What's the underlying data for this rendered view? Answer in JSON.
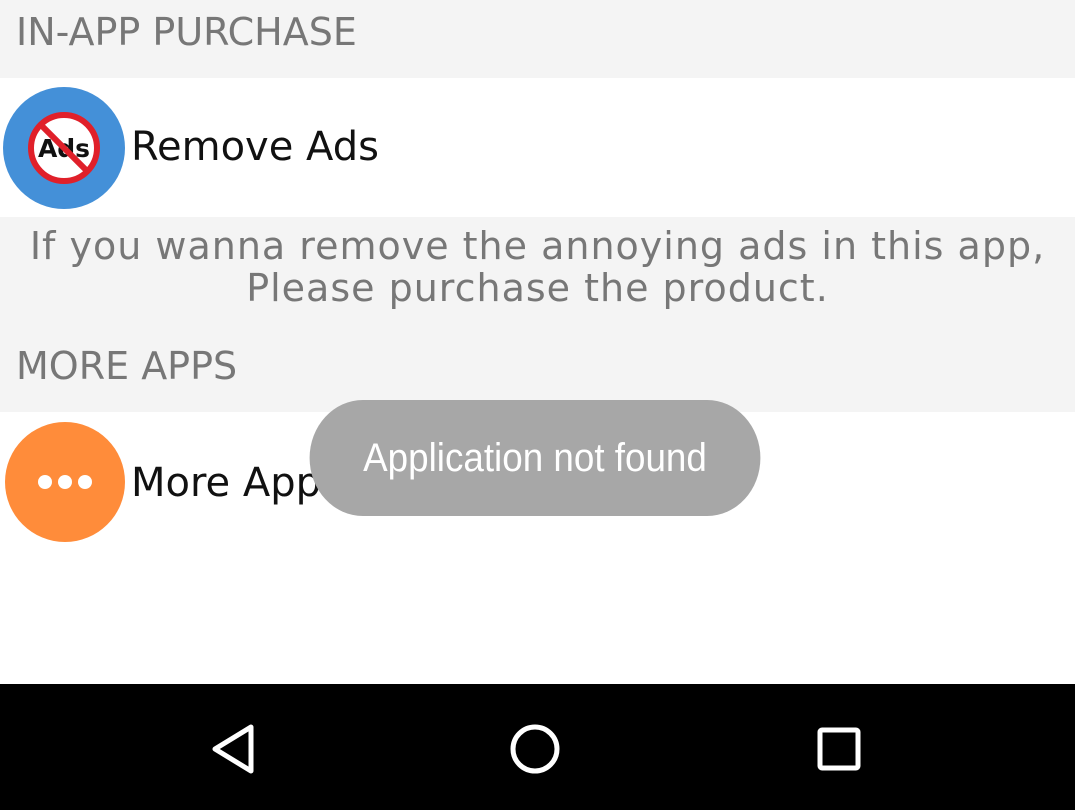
{
  "sections": {
    "in_app_purchase": {
      "header": "IN-APP PURCHASE",
      "remove_ads": {
        "label": "Remove Ads",
        "icon": "no-ads-icon",
        "icon_text": "Ads",
        "icon_color": "#4490d8"
      },
      "description": {
        "line1": "If you wanna remove the annoying ads in this app,",
        "line2": "Please purchase the product."
      }
    },
    "more_apps": {
      "header": "MORE APPS",
      "more_apps_item": {
        "label": "More Apps",
        "icon": "more-dots-icon",
        "icon_color": "#ff8c3a"
      }
    }
  },
  "toast": {
    "message": "Application not found"
  },
  "navbar": {
    "back_icon": "back-triangle-icon",
    "home_icon": "home-circle-icon",
    "recents_icon": "recents-square-icon"
  }
}
